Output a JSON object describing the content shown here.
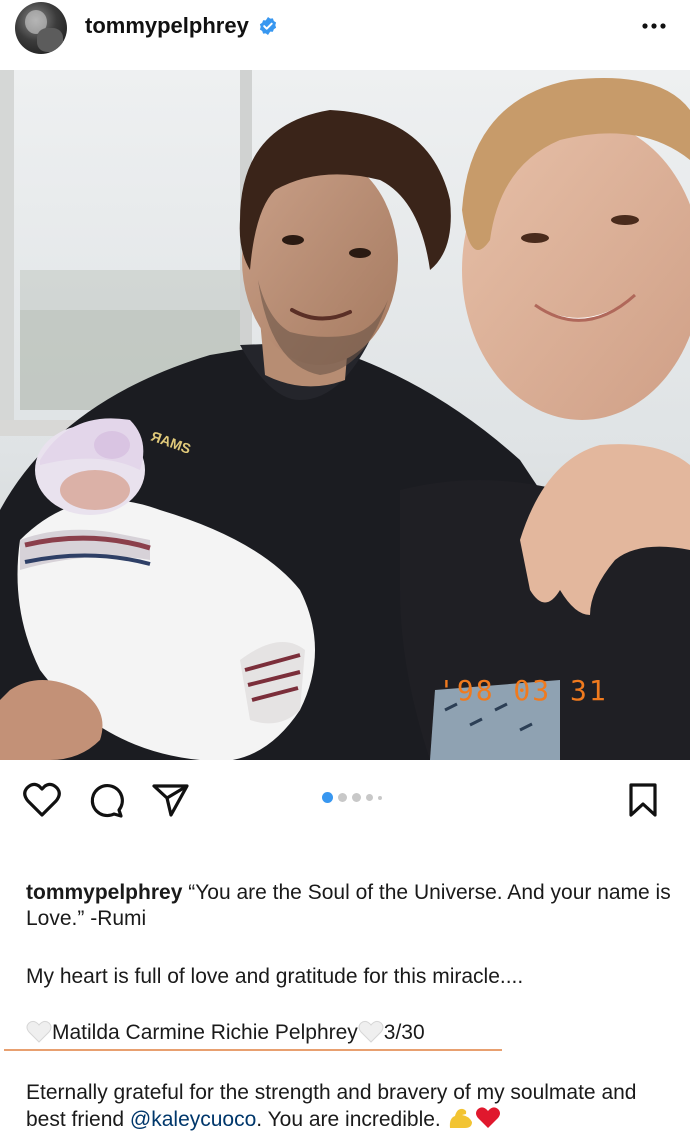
{
  "post": {
    "username": "tommypelphrey",
    "verified": true,
    "menu_icon": "more-horizontal-icon"
  },
  "photo": {
    "date_stamp": "'98 03 31",
    "carousel_total": 5,
    "carousel_active": 1
  },
  "actions": {
    "like_icon": "heart-icon",
    "comment_icon": "comment-icon",
    "share_icon": "send-icon",
    "save_icon": "bookmark-icon"
  },
  "caption": {
    "username": "tommypelphrey",
    "quote": "“You are the Soul of the Universe.  And your name is Love.” -Rumi",
    "line2": "My heart is full of love and gratitude for this miracle....",
    "baby_name": "Matilda Carmine Richie Pelphrey",
    "date": "3/30",
    "line4_start": "Eternally grateful for the strength and bravery of my soulmate and best friend ",
    "mention": "@kaleycuoco",
    "line4_end": ". You are incredible. "
  }
}
